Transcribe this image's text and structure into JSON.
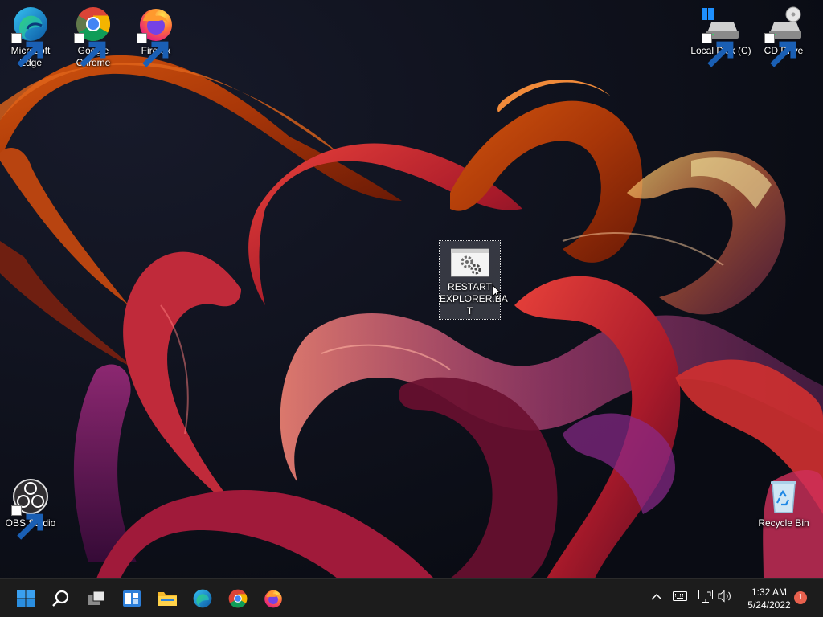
{
  "desktop": {
    "icons": [
      {
        "label": "Microsoft\nEdge",
        "icon": "edge-icon",
        "shortcut": true
      },
      {
        "label": "Google\nChrome",
        "icon": "chrome-icon",
        "shortcut": true
      },
      {
        "label": "Firefox",
        "icon": "firefox-icon",
        "shortcut": true
      },
      {
        "label": "Local Disk (C)",
        "icon": "drive-icon",
        "shortcut": true
      },
      {
        "label": "CD Drive",
        "icon": "cd-drive-icon",
        "shortcut": true
      },
      {
        "label": "OBS Studio",
        "icon": "obs-icon",
        "shortcut": true
      },
      {
        "label": "Recycle Bin",
        "icon": "recycle-bin-icon",
        "shortcut": false
      },
      {
        "label": "RESTART\nEXPLORER.BA\nT",
        "icon": "batch-file-icon",
        "shortcut": false,
        "selected": true
      }
    ]
  },
  "taskbar": {
    "items": [
      {
        "name": "Start",
        "icon": "windows-start-icon"
      },
      {
        "name": "Search",
        "icon": "search-icon"
      },
      {
        "name": "Task View",
        "icon": "task-view-icon"
      },
      {
        "name": "Widgets",
        "icon": "widgets-icon"
      },
      {
        "name": "File Explorer",
        "icon": "folder-icon"
      },
      {
        "name": "Microsoft Edge",
        "icon": "edge-icon"
      },
      {
        "name": "Google Chrome",
        "icon": "chrome-icon"
      },
      {
        "name": "Firefox",
        "icon": "firefox-icon"
      }
    ],
    "tray": {
      "icons": [
        "chevron-up-icon",
        "keyboard-icon",
        "network-icon",
        "volume-icon"
      ],
      "time": "1:32 AM",
      "date": "5/24/2022",
      "notification_count": "1"
    }
  },
  "colors": {
    "taskbar_bg": "#1c1c1c",
    "accent": "#0078d4",
    "badge": "#e8614e",
    "wallpaper_bg": "#0b0e17"
  }
}
